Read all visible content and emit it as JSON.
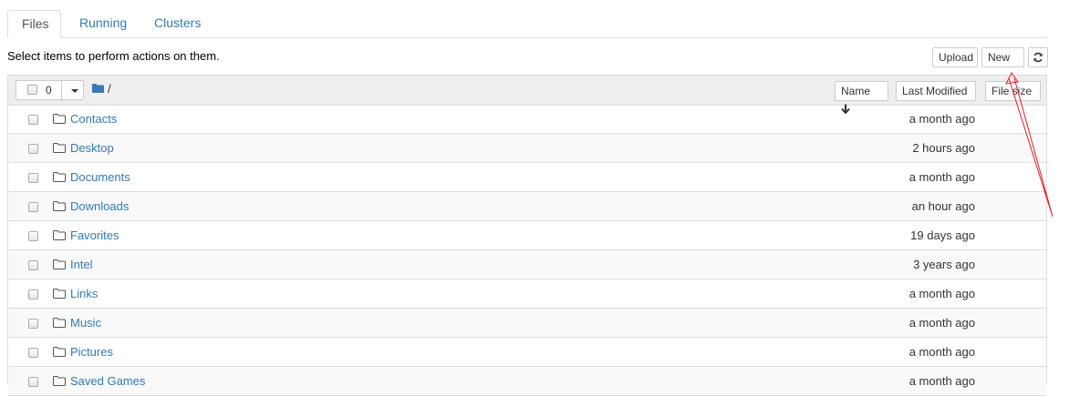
{
  "tabs": [
    {
      "label": "Files",
      "active": true
    },
    {
      "label": "Running",
      "active": false
    },
    {
      "label": "Clusters",
      "active": false
    }
  ],
  "instructions": "Select items to perform actions on them.",
  "toolbar": {
    "upload_label": "Upload",
    "new_label": "New",
    "refresh_icon": "refresh-icon"
  },
  "list_header": {
    "selected_count": "0",
    "breadcrumb": "/",
    "sort_name_label": "Name",
    "sort_modified_label": "Last Modified",
    "sort_size_label": "File size"
  },
  "rows": [
    {
      "name": "Contacts",
      "modified": "a month ago"
    },
    {
      "name": "Desktop",
      "modified": "2 hours ago"
    },
    {
      "name": "Documents",
      "modified": "a month ago"
    },
    {
      "name": "Downloads",
      "modified": "an hour ago"
    },
    {
      "name": "Favorites",
      "modified": "19 days ago"
    },
    {
      "name": "Intel",
      "modified": "3 years ago"
    },
    {
      "name": "Links",
      "modified": "a month ago"
    },
    {
      "name": "Music",
      "modified": "a month ago"
    },
    {
      "name": "Pictures",
      "modified": "a month ago"
    },
    {
      "name": "Saved Games",
      "modified": "a month ago"
    }
  ],
  "colors": {
    "link": "#337ab7",
    "header_bg": "#eeeeee",
    "annotation_arrow": "#e0202a"
  }
}
